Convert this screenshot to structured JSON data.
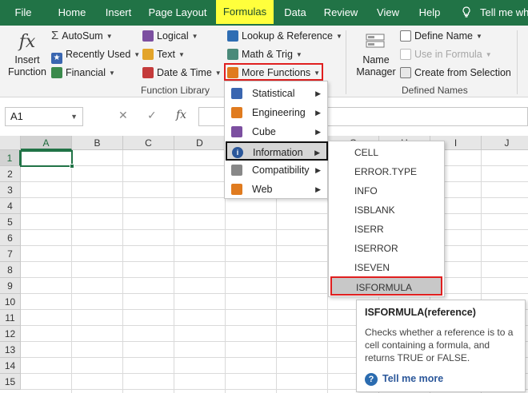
{
  "tabs": [
    "File",
    "Home",
    "Insert",
    "Page Layout",
    "Formulas",
    "Data",
    "Review",
    "View",
    "Help"
  ],
  "active_tab": "Formulas",
  "tell_me": "Tell me wh",
  "ribbon": {
    "insert_function": {
      "line1": "Insert",
      "line2": "Function",
      "icon_text": "fx"
    },
    "autosum": "AutoSum",
    "recently_used": "Recently Used",
    "financial": "Financial",
    "logical": "Logical",
    "text": "Text",
    "date_time": "Date & Time",
    "lookup_reference": "Lookup & Reference",
    "math_trig": "Math & Trig",
    "more_functions": "More Functions",
    "function_library_label": "Function Library",
    "name_manager": {
      "line1": "Name",
      "line2": "Manager"
    },
    "define_name": "Define Name",
    "use_in_formula": "Use in Formula",
    "create_from_selection": "Create from Selection",
    "defined_names_label": "Defined Names"
  },
  "formula_bar": {
    "name_box": "A1",
    "cancel_icon": "✕",
    "enter_icon": "✓",
    "fx_icon": "fx",
    "formula": ""
  },
  "grid": {
    "columns": [
      "A",
      "B",
      "C",
      "D",
      "E",
      "F",
      "G",
      "H",
      "I",
      "J"
    ],
    "rows": [
      "1",
      "2",
      "3",
      "4",
      "5",
      "6",
      "7",
      "8",
      "9",
      "10",
      "11",
      "12",
      "13",
      "14",
      "15"
    ],
    "selected_cell": "A1"
  },
  "more_functions_menu": [
    "Statistical",
    "Engineering",
    "Cube",
    "Information",
    "Compatibility",
    "Web"
  ],
  "more_functions_highlighted": "Information",
  "information_submenu": [
    "CELL",
    "ERROR.TYPE",
    "INFO",
    "ISBLANK",
    "ISERR",
    "ISERROR",
    "ISEVEN",
    "ISFORMULA"
  ],
  "information_highlighted": "ISFORMULA",
  "tooltip": {
    "title": "ISFORMULA(reference)",
    "body": "Checks whether a reference is to a cell containing a formula, and returns TRUE or FALSE.",
    "link": "Tell me more"
  },
  "colors": {
    "excel_green": "#217346",
    "highlight_yellow": "#ffff3c",
    "callout_red": "#e01f1f"
  }
}
